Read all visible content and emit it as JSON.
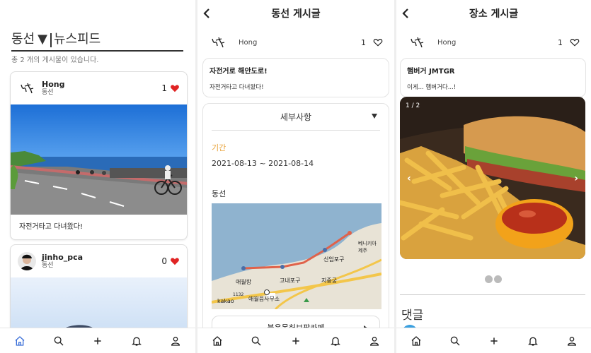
{
  "colors": {
    "accent": "#3b6fd8",
    "heart": "#e02424",
    "orange": "#e8a33a"
  },
  "feed": {
    "title_main": "동선",
    "dropdown_glyph": "▼",
    "title_sub": "뉴스피드",
    "count_text": "총 2 개의 게시물이 있습니다.",
    "cards": [
      {
        "user": "Hong",
        "tag": "동선",
        "likes": "1",
        "caption": "자전거타고 다녀왔다!"
      },
      {
        "user": "jinho_pca",
        "tag": "동선",
        "likes": "0",
        "caption": ""
      }
    ]
  },
  "route_post": {
    "title": "동선 게시글",
    "user": "Hong",
    "likes": "1",
    "post_title": "자전거로 해안도로!",
    "post_body": "자전거타고 다녀왔다!",
    "details_label": "세부사항",
    "period_label": "기간",
    "period_value": "2021-08-13 ~ 2021-08-14",
    "route_label": "동선",
    "map_labels": {
      "a": "애월항",
      "b": "고내포구",
      "c": "신엄포구",
      "d": "지중궁",
      "e": "애월읍사무소",
      "f": "kakao",
      "g": "베니키아\n제주",
      "h": "1132"
    },
    "place_button": "붉은못허브팜카페"
  },
  "place_post": {
    "title": "장소 게시글",
    "user": "Hong",
    "likes": "1",
    "post_title": "햄버거 JMTGR",
    "post_body": "이게... 햄버거다...!",
    "pager": "1 / 2",
    "comments_label": "댓글"
  },
  "tabbar": {
    "icons": [
      "home-icon",
      "search-icon",
      "plus-icon",
      "bell-icon",
      "user-icon"
    ]
  }
}
